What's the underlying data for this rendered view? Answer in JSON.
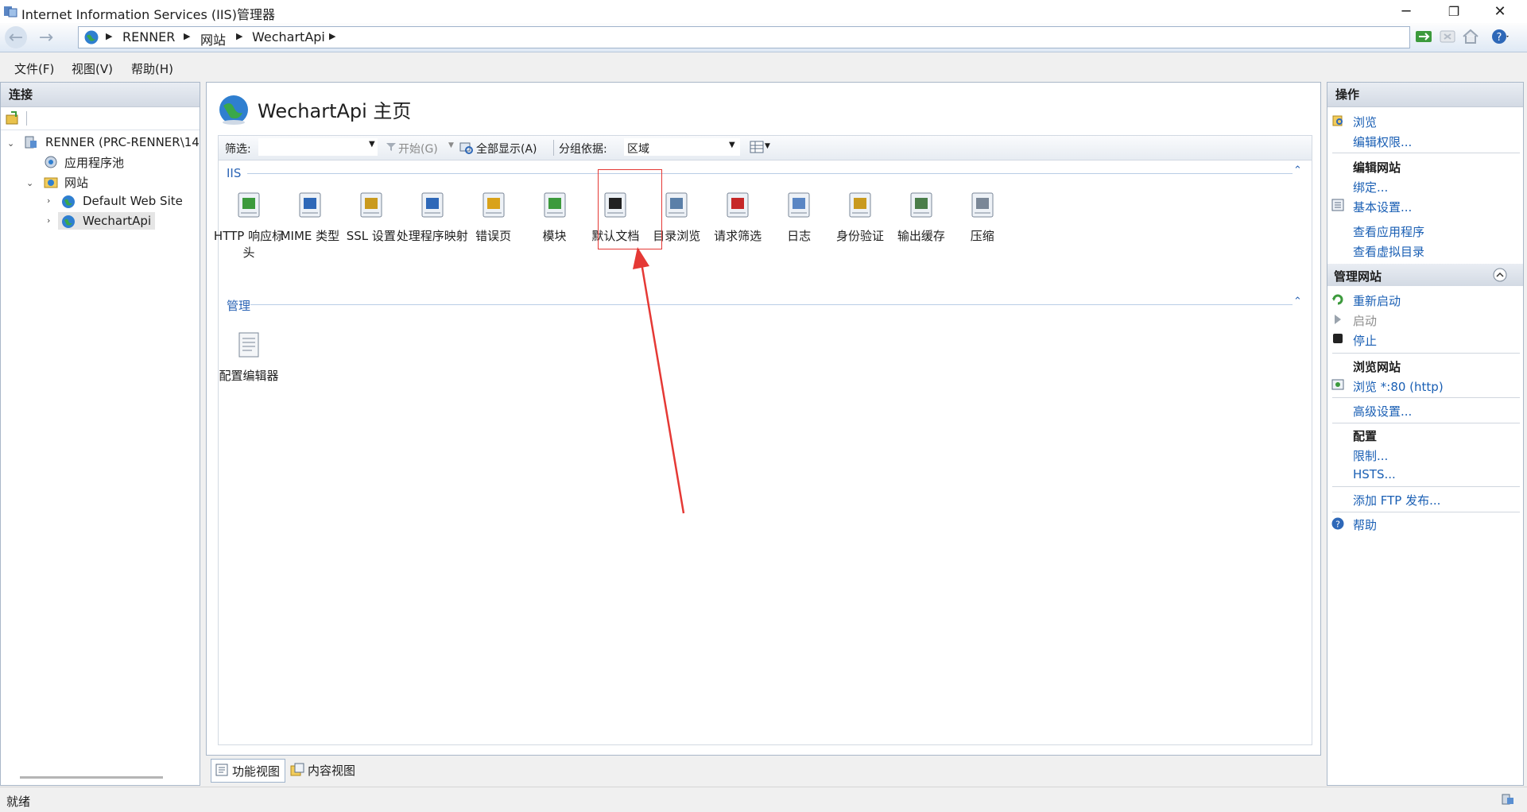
{
  "window": {
    "title": "Internet Information Services (IIS)管理器",
    "min": "─",
    "restore": "❐",
    "close": "✕"
  },
  "address": {
    "crumbs": [
      "RENNER",
      "网站",
      "WechartApi"
    ]
  },
  "menu": [
    "文件(F)",
    "视图(V)",
    "帮助(H)"
  ],
  "connections": {
    "title": "连接",
    "tree": [
      {
        "label": "RENNER (PRC-RENNER\\14"
      },
      {
        "label": "应用程序池"
      },
      {
        "label": "网站"
      },
      {
        "label": "Default Web Site"
      },
      {
        "label": "WechartApi"
      }
    ]
  },
  "main": {
    "title": "WechartApi 主页",
    "filter_label": "筛选:",
    "go_label": "开始(G)",
    "show_all_label": "全部显示(A)",
    "group_by_label": "分组依据:",
    "group_by_value": "区域",
    "groups": [
      {
        "name": "IIS",
        "features": [
          "HTTP 响应标头",
          "MIME 类型",
          "SSL 设置",
          "处理程序映射",
          "错误页",
          "模块",
          "默认文档",
          "目录浏览",
          "请求筛选",
          "日志",
          "身份验证",
          "输出缓存",
          "压缩"
        ]
      },
      {
        "name": "管理",
        "features": [
          "配置编辑器"
        ]
      }
    ],
    "highlight_color": "#e53935"
  },
  "views": {
    "features_view": "功能视图",
    "content_view": "内容视图"
  },
  "actions": {
    "title": "操作",
    "browse": "浏览",
    "edit_permissions": "编辑权限...",
    "edit_site_head": "编辑网站",
    "bindings": "绑定...",
    "basic_settings": "基本设置...",
    "view_apps": "查看应用程序",
    "view_vdirs": "查看虚拟目录",
    "manage_site_head": "管理网站",
    "restart": "重新启动",
    "start": "启动",
    "stop": "停止",
    "browse_site_head": "浏览网站",
    "browse_80": "浏览 *:80 (http)",
    "advanced_settings": "高级设置...",
    "config_head": "配置",
    "limits": "限制...",
    "hsts": "HSTS...",
    "add_ftp": "添加 FTP 发布...",
    "help": "帮助"
  },
  "status": {
    "text": "就绪"
  }
}
